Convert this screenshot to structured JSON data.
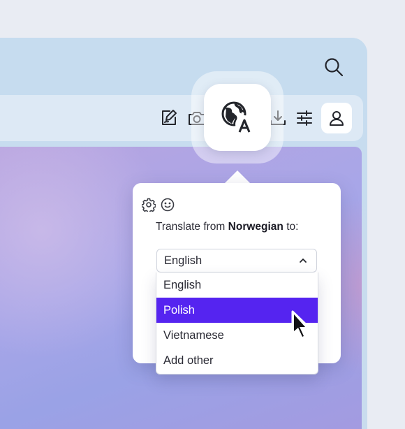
{
  "toolbar": {
    "search_icon": "search-icon",
    "icons": [
      "sign-document-icon",
      "camera-icon",
      "translate-icon",
      "download-icon",
      "sliders-icon",
      "account-icon"
    ]
  },
  "translate_button": {
    "icon": "globe-translate-icon"
  },
  "popover": {
    "settings_icon": "gear-icon",
    "emoji_icon": "smiley-icon",
    "prompt_prefix": "Translate from ",
    "source_language": "Norwegian",
    "prompt_suffix": " to:",
    "select": {
      "value": "English",
      "expanded": true
    },
    "options": [
      "English",
      "Polish",
      "Vietnamese",
      "Add other"
    ],
    "highlighted_option": "Polish"
  },
  "colors": {
    "accent": "#5524f0",
    "popover_bg": "#ffffff",
    "text": "#2b2b35"
  }
}
